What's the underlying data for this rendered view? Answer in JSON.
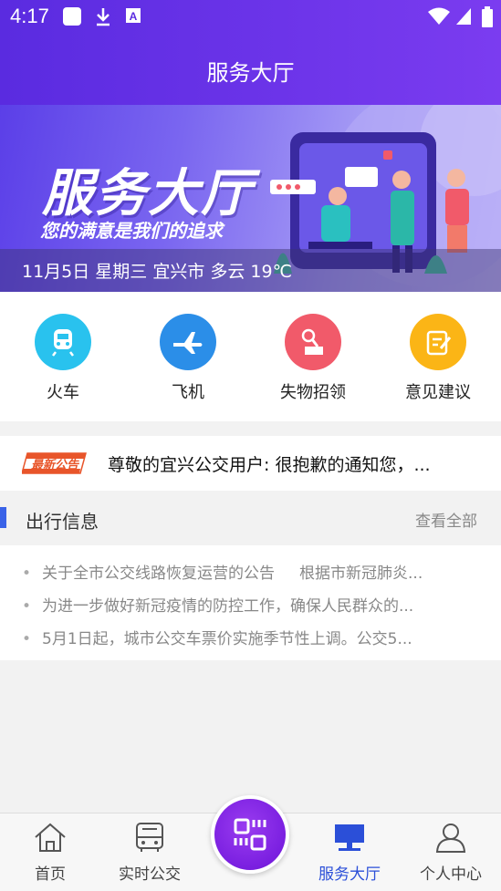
{
  "status_bar": {
    "time": "4:17",
    "icons": [
      "notification-square-icon",
      "download-icon",
      "font-a-icon",
      "wifi-icon",
      "signal-icon",
      "battery-icon"
    ]
  },
  "header": {
    "title": "服务大厅"
  },
  "banner": {
    "title": "服务大厅",
    "subtitle": "您的满意是我们的追求",
    "weather": "11月5日 星期三 宜兴市 多云 19℃"
  },
  "quick_menu": [
    {
      "label": "火车",
      "icon": "train-icon",
      "color": "#29c2ee"
    },
    {
      "label": "飞机",
      "icon": "airplane-icon",
      "color": "#2b8ee8"
    },
    {
      "label": "失物招领",
      "icon": "lost-found-icon",
      "color": "#f15a6a"
    },
    {
      "label": "意见建议",
      "icon": "feedback-icon",
      "color": "#fbb516"
    }
  ],
  "notice": {
    "tag": "最新公告",
    "text": "尊敬的宜兴公交用户: 很抱歉的通知您，..."
  },
  "travel_info": {
    "title": "出行信息",
    "more": "查看全部",
    "items": [
      "关于全市公交线路恢复运营的公告     根据市新冠肺炎...",
      "为进一步做好新冠疫情的防控工作，确保人民群众的...",
      "5月1日起，城市公交车票价实施季节性上调。公交5..."
    ]
  },
  "bottom_nav": {
    "items": [
      {
        "label": "首页",
        "icon": "home-icon"
      },
      {
        "label": "实时公交",
        "icon": "bus-icon"
      },
      {
        "label": "服务大厅",
        "icon": "service-hall-icon",
        "active": true
      },
      {
        "label": "个人中心",
        "icon": "user-icon"
      }
    ],
    "center_icon": "scan-code-icon"
  },
  "colors": {
    "header_gradient_start": "#5a2be0",
    "header_gradient_end": "#7b3cf0",
    "accent_blue": "#2b4fd8",
    "section_bar": "#3a63e8",
    "notice_tag": "#e8552a"
  }
}
